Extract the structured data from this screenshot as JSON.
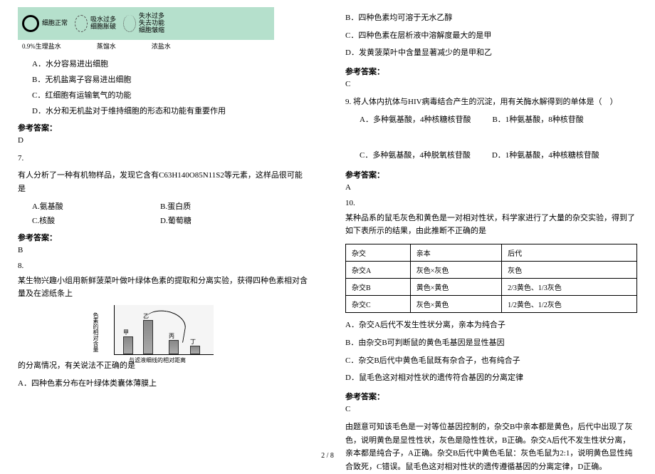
{
  "left": {
    "fig": {
      "cell1_label": "细胞正常",
      "cell2_label1": "吸水过多",
      "cell2_label2": "细胞胀破",
      "cell3_label1": "失水过多",
      "cell3_label2": "失去功能",
      "cell3_label3": "细胞皱缩",
      "env1": "0.9%生理盐水",
      "env2": "蒸馏水",
      "env3": "浓盐水"
    },
    "q6": {
      "a": "A．水分容易进出细胞",
      "b": "B．无机盐离子容易进出细胞",
      "c": "C．红细胞有运输氧气的功能",
      "d": "D．水分和无机盐对于维持细胞的形态和功能有重要作用",
      "ans_label": "参考答案：",
      "ans": "D"
    },
    "q7": {
      "num": "7.",
      "stem": "有人分析了一种有机物样品，发现它含有C63H140O85N11S2等元素，这样品很可能是",
      "a": "A.氨基酸",
      "b": "B.蛋白质",
      "c": "C.核酸",
      "d": "D.葡萄糖",
      "ans_label": "参考答案：",
      "ans": "B"
    },
    "q8": {
      "num": "8.",
      "stem_pre": "某生物兴趣小组用新鲜菠菜叶做叶绿体色素的提取和分离实验，获得四种色素相对含量及在滤纸条上",
      "stem_post": "的分离情况，有关说法不正确的是",
      "a": "A．四种色素分布在叶绿体类囊体薄膜上",
      "chart": {
        "ylabel": "色素的相对含量",
        "xlabel": "与滤液细线的相对距离",
        "bars": [
          "甲",
          "乙",
          "丙",
          "丁"
        ]
      }
    }
  },
  "right": {
    "q8cont": {
      "b": "B．四种色素均可溶于无水乙醇",
      "c": "C．四种色素在层析液中溶解度最大的是甲",
      "d": "D．发黄菠菜叶中含量显著减少的是甲和乙",
      "ans_label": "参考答案：",
      "ans": "C"
    },
    "q9": {
      "stem": "9. 将人体内抗体与HIV病毒结合产生的沉淀，用有关酶水解得到的单体是（　）",
      "a": "A．多种氨基酸，4种核糖核苷酸",
      "b": "B．1种氨基酸，8种核苷酸",
      "c": "C．多种氨基酸，4种脱氧核苷酸",
      "d": "D．1种氨基酸，4种核糖核苷酸",
      "ans_label": "参考答案：",
      "ans": "A"
    },
    "q10": {
      "num": "10.",
      "stem": "某种品系的鼠毛灰色和黄色是一对相对性状，科学家进行了大量的杂交实验，得到了如下表所示的结果，由此推断不正确的是",
      "table": {
        "h1": "杂交",
        "h2": "亲本",
        "h3": "后代",
        "r1c1": "杂交A",
        "r1c2": "灰色×灰色",
        "r1c3": "灰色",
        "r2c1": "杂交B",
        "r2c2": "黄色×黄色",
        "r2c3": "2/3黄色、1/3灰色",
        "r3c1": "杂交C",
        "r3c2": "灰色×黄色",
        "r3c3": "1/2黄色、1/2灰色"
      },
      "a": "A．杂交A后代不发生性状分离，亲本为纯合子",
      "b": "B．由杂交B可判断鼠的黄色毛基因是显性基因",
      "c": "C．杂交B后代中黄色毛鼠既有杂合子，也有纯合子",
      "d": "D．鼠毛色这对相对性状的遗传符合基因的分离定律",
      "ans_label": "参考答案：",
      "ans": "C",
      "exp": "由题意可知该毛色是一对等位基因控制的，杂交B中亲本都是黄色，后代中出现了灰色，说明黄色是显性性状，灰色是隐性性状，B正确。杂交A后代不发生性状分离，亲本都是纯合子，A正确。杂交B后代中黄色毛鼠：灰色毛鼠为2:1，说明黄色显性纯合致死，C错误。鼠毛色这对相对性状的遗传遵循基因的分离定律，D正确。"
    }
  },
  "pagenum": "2 / 8"
}
